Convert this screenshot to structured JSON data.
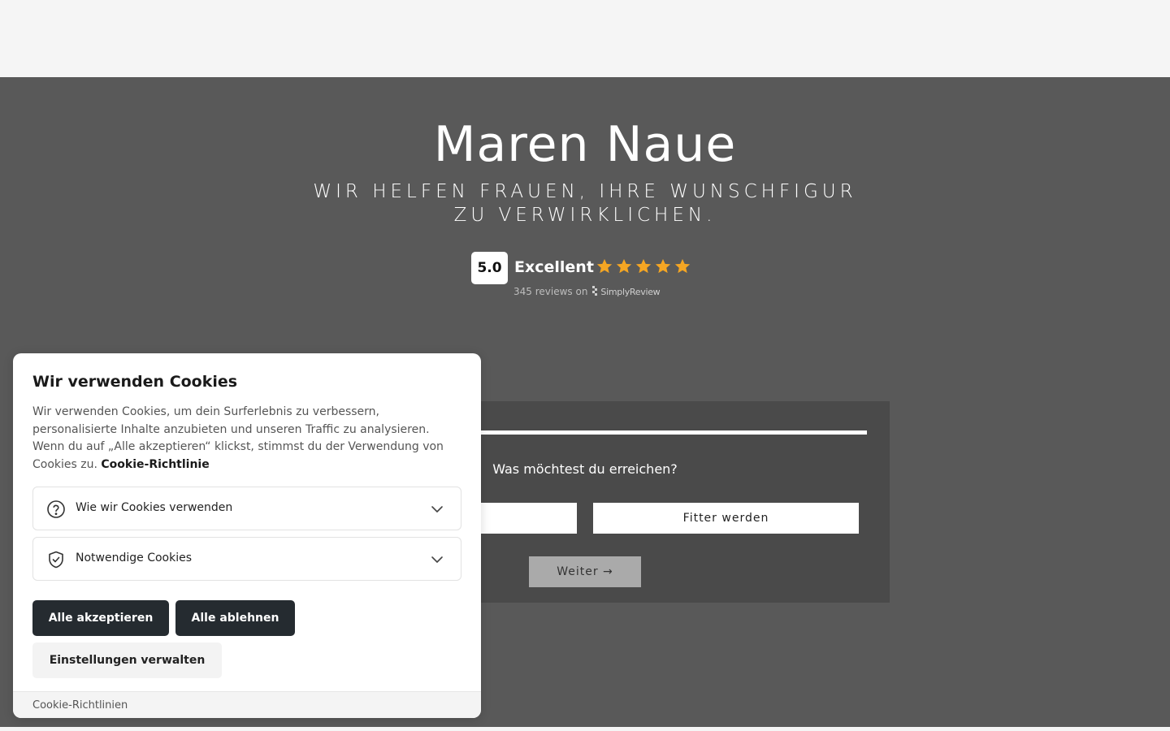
{
  "hero": {
    "title": "Maren Naue",
    "subtitle": "WIR HELFEN FRAUEN, IHRE WUNSCHFIGUR ZU VERWIRKLICHEN.",
    "background_color": "#595959"
  },
  "rating": {
    "score": "5.0",
    "label": "Excellent",
    "stars": 5,
    "star_color": "#f5a623",
    "reviews_text": "345 reviews on",
    "provider": "SimplyReview"
  },
  "quiz": {
    "progress": 1.0,
    "question": "Was möchtest du erreichen?",
    "options": [
      "",
      "Fitter werden"
    ],
    "next_label": "Weiter →"
  },
  "cookie_banner": {
    "title": "Wir verwenden Cookies",
    "text": "Wir verwenden Cookies, um dein Surferlebnis zu verbessern, personalisierte Inhalte anzubieten und unseren Traffic zu analysieren. Wenn du auf „Alle akzeptieren“ klickst, stimmst du der Verwendung von Cookies zu.",
    "policy_link": "Cookie-Richtlinie",
    "accordions": [
      {
        "label": "Wie wir Cookies verwenden",
        "icon": "question-circle-icon"
      },
      {
        "label": "Notwendige Cookies",
        "icon": "shield-check-icon"
      }
    ],
    "accept_all": "Alle akzeptieren",
    "reject_all": "Alle ablehnen",
    "manage": "Einstellungen verwalten",
    "footer_link": "Cookie-Richtlinien"
  }
}
